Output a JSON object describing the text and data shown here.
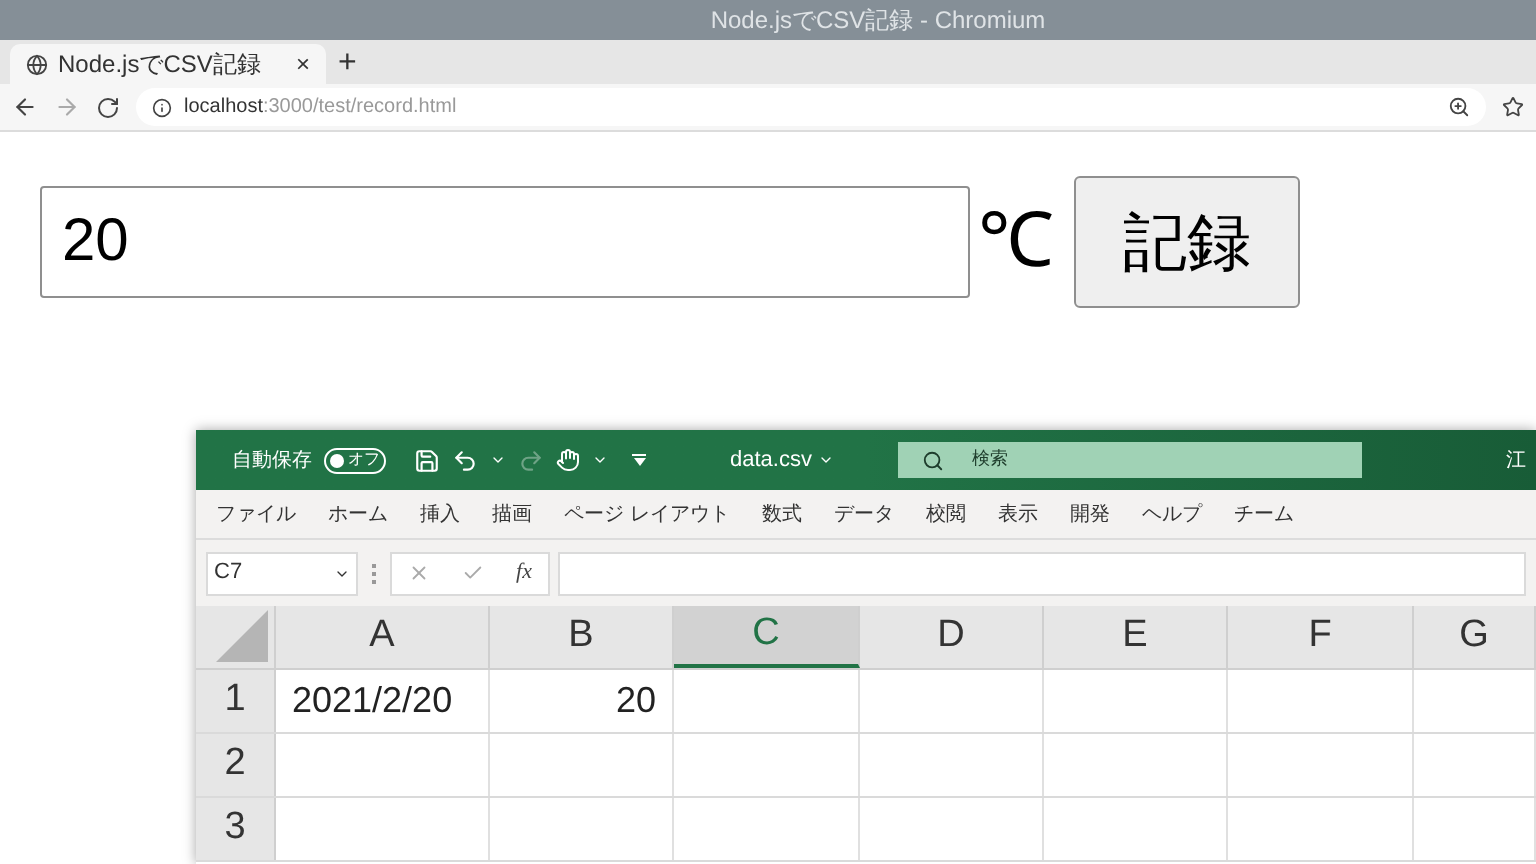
{
  "browser": {
    "title": "Node.jsでCSV記録 - Chromium",
    "tabs": [
      {
        "label": "Node.jsでCSV記録",
        "close": "×"
      }
    ],
    "new_tab": "+",
    "url_host": "localhost",
    "url_path": ":3000/test/record.html"
  },
  "page": {
    "temperature_field": {
      "value": "20"
    },
    "unit": "℃",
    "record_button": "記録"
  },
  "excel": {
    "autosave_label": "自動保存",
    "autosave_toggle": {
      "label": "オフ",
      "on": false
    },
    "file_name": "data.csv",
    "search": {
      "placeholder": "検索"
    },
    "user": "江",
    "ribbon_tabs": [
      "ファイル",
      "ホーム",
      "挿入",
      "描画",
      "ページ レイアウト",
      "数式",
      "データ",
      "校閲",
      "表示",
      "開発",
      "ヘルプ",
      "チーム"
    ],
    "name_box": "C7",
    "fx_label": "fx",
    "columns": [
      {
        "label": "A",
        "selected": false
      },
      {
        "label": "B",
        "selected": false
      },
      {
        "label": "C",
        "selected": true
      },
      {
        "label": "D",
        "selected": false
      },
      {
        "label": "E",
        "selected": false
      },
      {
        "label": "F",
        "selected": false
      },
      {
        "label": "G",
        "selected": false
      }
    ],
    "rows": [
      {
        "label": "1",
        "cells": [
          {
            "text": "2021/2/20",
            "kind": "text"
          },
          {
            "text": "20",
            "kind": "number"
          }
        ]
      },
      {
        "label": "2",
        "cells": []
      },
      {
        "label": "3",
        "cells": []
      }
    ]
  }
}
